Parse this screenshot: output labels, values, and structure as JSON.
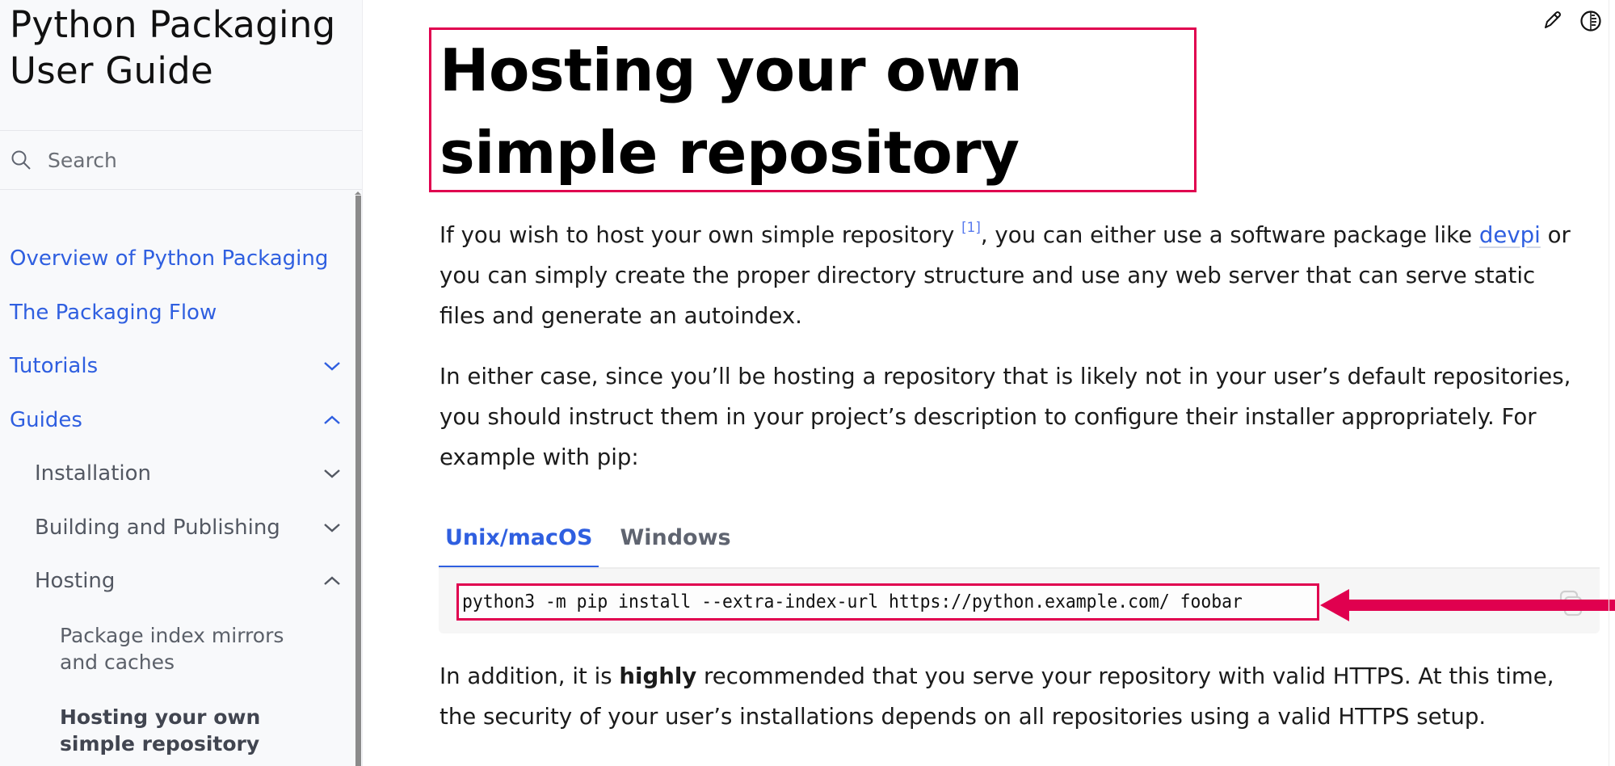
{
  "sidebar": {
    "brand": "Python Packaging User Guide",
    "search": {
      "placeholder": "Search",
      "icon": "search-icon"
    },
    "items": [
      {
        "label": "Overview of Python Packaging",
        "level": 1
      },
      {
        "label": "The Packaging Flow",
        "level": 1
      },
      {
        "label": "Tutorials",
        "level": 1,
        "toggle": "chevron-down-icon"
      },
      {
        "label": "Guides",
        "level": 1,
        "toggle": "chevron-up-icon"
      },
      {
        "label": "Installation",
        "level": 2,
        "toggle": "chevron-down-icon"
      },
      {
        "label": "Building and Publishing",
        "level": 2,
        "toggle": "chevron-down-icon"
      },
      {
        "label": "Hosting",
        "level": 2,
        "toggle": "chevron-up-icon"
      },
      {
        "label": "Package index mirrors and caches",
        "level": 3
      },
      {
        "label": "Hosting your own simple repository",
        "level": 3,
        "current": true
      }
    ]
  },
  "toolbar": {
    "edit_icon": "pencil-icon",
    "theme_icon": "contrast-icon"
  },
  "main": {
    "title": "Hosting your own simple repository",
    "para1": {
      "before": "If you wish to host your own simple repository ",
      "footnote": "[1]",
      "middle": ", you can either use a software package like ",
      "link": "devpi",
      "after": " or you can simply create the proper directory structure and use any web server that can serve static files and generate an autoindex."
    },
    "para2": "In either case, since you’ll be hosting a repository that is likely not in your user’s default repositories, you should instruct them in your project’s description to configure their installer appropriately. For example with pip:",
    "tabs": [
      {
        "label": "Unix/macOS",
        "active": true
      },
      {
        "label": "Windows",
        "active": false
      }
    ],
    "code": "python3 -m pip install --extra-index-url https://python.example.com/ foobar",
    "para3": {
      "before": "In addition, it is ",
      "bold": "highly",
      "after": " recommended that you serve your repository with valid HTTPS. At this time, the security of your user’s installations depends on all repositories using a valid HTTPS setup."
    }
  },
  "annotations": {
    "highlight_color": "#e0004f"
  },
  "colors": {
    "link": "#2f5fe0",
    "sidebar_bg": "#f8f9fb"
  }
}
